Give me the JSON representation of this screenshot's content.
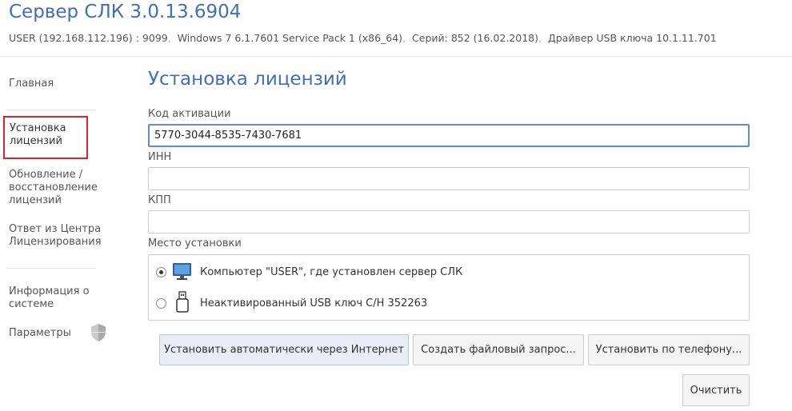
{
  "header": {
    "title": "Сервер СЛК 3.0.13.6904",
    "info": {
      "host": "USER (192.168.112.196) : 9099",
      "os": "Windows 7 6.1.7601 Service Pack 1 (x86_64)",
      "series": "Серий: 852 (16.02.2018)",
      "driver": "Драйвер USB ключа 10.1.11.701"
    }
  },
  "sidebar": {
    "items": [
      {
        "label": "Главная"
      },
      {
        "label": "Установка\nлицензий"
      },
      {
        "label": "Обновление /\nвосстановление\nлицензий"
      },
      {
        "label": "Ответ из Центра\nЛицензирования"
      },
      {
        "label": "Информация о\nсистеме"
      },
      {
        "label": "Параметры",
        "icon": "shield-icon"
      }
    ],
    "active_index": 1
  },
  "main": {
    "title": "Установка лицензий",
    "activation_code": {
      "label": "Код активации",
      "value": "5770-3044-8535-7430-7681"
    },
    "inn": {
      "label": "ИНН",
      "value": ""
    },
    "kpp": {
      "label": "КПП",
      "value": ""
    },
    "install_location": {
      "label": "Место установки",
      "options": [
        {
          "label": "Компьютер \"USER\", где установлен сервер СЛК",
          "icon": "monitor-icon",
          "selected": true
        },
        {
          "label": "Неактивированный USB ключ С/Н 352263",
          "icon": "usb-key-icon",
          "selected": false
        }
      ]
    },
    "buttons": {
      "install_online": "Установить автоматически через Интернет",
      "file_request": "Создать файловый запрос...",
      "phone": "Установить по телефону...",
      "clear": "Очистить"
    }
  },
  "colors": {
    "accent": "#3f6fb8",
    "active_border": "#d9232d",
    "focus_border": "#5b8dd9"
  }
}
